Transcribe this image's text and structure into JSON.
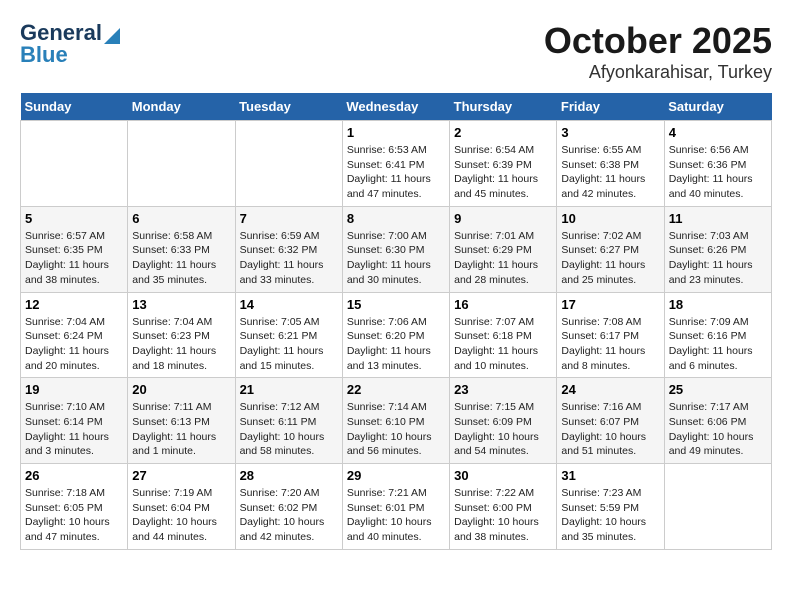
{
  "header": {
    "logo_line1": "General",
    "logo_line2": "Blue",
    "month": "October 2025",
    "location": "Afyonkarahisar, Turkey"
  },
  "days_of_week": [
    "Sunday",
    "Monday",
    "Tuesday",
    "Wednesday",
    "Thursday",
    "Friday",
    "Saturday"
  ],
  "weeks": [
    [
      {
        "day": "",
        "info": ""
      },
      {
        "day": "",
        "info": ""
      },
      {
        "day": "",
        "info": ""
      },
      {
        "day": "1",
        "info": "Sunrise: 6:53 AM\nSunset: 6:41 PM\nDaylight: 11 hours\nand 47 minutes."
      },
      {
        "day": "2",
        "info": "Sunrise: 6:54 AM\nSunset: 6:39 PM\nDaylight: 11 hours\nand 45 minutes."
      },
      {
        "day": "3",
        "info": "Sunrise: 6:55 AM\nSunset: 6:38 PM\nDaylight: 11 hours\nand 42 minutes."
      },
      {
        "day": "4",
        "info": "Sunrise: 6:56 AM\nSunset: 6:36 PM\nDaylight: 11 hours\nand 40 minutes."
      }
    ],
    [
      {
        "day": "5",
        "info": "Sunrise: 6:57 AM\nSunset: 6:35 PM\nDaylight: 11 hours\nand 38 minutes."
      },
      {
        "day": "6",
        "info": "Sunrise: 6:58 AM\nSunset: 6:33 PM\nDaylight: 11 hours\nand 35 minutes."
      },
      {
        "day": "7",
        "info": "Sunrise: 6:59 AM\nSunset: 6:32 PM\nDaylight: 11 hours\nand 33 minutes."
      },
      {
        "day": "8",
        "info": "Sunrise: 7:00 AM\nSunset: 6:30 PM\nDaylight: 11 hours\nand 30 minutes."
      },
      {
        "day": "9",
        "info": "Sunrise: 7:01 AM\nSunset: 6:29 PM\nDaylight: 11 hours\nand 28 minutes."
      },
      {
        "day": "10",
        "info": "Sunrise: 7:02 AM\nSunset: 6:27 PM\nDaylight: 11 hours\nand 25 minutes."
      },
      {
        "day": "11",
        "info": "Sunrise: 7:03 AM\nSunset: 6:26 PM\nDaylight: 11 hours\nand 23 minutes."
      }
    ],
    [
      {
        "day": "12",
        "info": "Sunrise: 7:04 AM\nSunset: 6:24 PM\nDaylight: 11 hours\nand 20 minutes."
      },
      {
        "day": "13",
        "info": "Sunrise: 7:04 AM\nSunset: 6:23 PM\nDaylight: 11 hours\nand 18 minutes."
      },
      {
        "day": "14",
        "info": "Sunrise: 7:05 AM\nSunset: 6:21 PM\nDaylight: 11 hours\nand 15 minutes."
      },
      {
        "day": "15",
        "info": "Sunrise: 7:06 AM\nSunset: 6:20 PM\nDaylight: 11 hours\nand 13 minutes."
      },
      {
        "day": "16",
        "info": "Sunrise: 7:07 AM\nSunset: 6:18 PM\nDaylight: 11 hours\nand 10 minutes."
      },
      {
        "day": "17",
        "info": "Sunrise: 7:08 AM\nSunset: 6:17 PM\nDaylight: 11 hours\nand 8 minutes."
      },
      {
        "day": "18",
        "info": "Sunrise: 7:09 AM\nSunset: 6:16 PM\nDaylight: 11 hours\nand 6 minutes."
      }
    ],
    [
      {
        "day": "19",
        "info": "Sunrise: 7:10 AM\nSunset: 6:14 PM\nDaylight: 11 hours\nand 3 minutes."
      },
      {
        "day": "20",
        "info": "Sunrise: 7:11 AM\nSunset: 6:13 PM\nDaylight: 11 hours\nand 1 minute."
      },
      {
        "day": "21",
        "info": "Sunrise: 7:12 AM\nSunset: 6:11 PM\nDaylight: 10 hours\nand 58 minutes."
      },
      {
        "day": "22",
        "info": "Sunrise: 7:14 AM\nSunset: 6:10 PM\nDaylight: 10 hours\nand 56 minutes."
      },
      {
        "day": "23",
        "info": "Sunrise: 7:15 AM\nSunset: 6:09 PM\nDaylight: 10 hours\nand 54 minutes."
      },
      {
        "day": "24",
        "info": "Sunrise: 7:16 AM\nSunset: 6:07 PM\nDaylight: 10 hours\nand 51 minutes."
      },
      {
        "day": "25",
        "info": "Sunrise: 7:17 AM\nSunset: 6:06 PM\nDaylight: 10 hours\nand 49 minutes."
      }
    ],
    [
      {
        "day": "26",
        "info": "Sunrise: 7:18 AM\nSunset: 6:05 PM\nDaylight: 10 hours\nand 47 minutes."
      },
      {
        "day": "27",
        "info": "Sunrise: 7:19 AM\nSunset: 6:04 PM\nDaylight: 10 hours\nand 44 minutes."
      },
      {
        "day": "28",
        "info": "Sunrise: 7:20 AM\nSunset: 6:02 PM\nDaylight: 10 hours\nand 42 minutes."
      },
      {
        "day": "29",
        "info": "Sunrise: 7:21 AM\nSunset: 6:01 PM\nDaylight: 10 hours\nand 40 minutes."
      },
      {
        "day": "30",
        "info": "Sunrise: 7:22 AM\nSunset: 6:00 PM\nDaylight: 10 hours\nand 38 minutes."
      },
      {
        "day": "31",
        "info": "Sunrise: 7:23 AM\nSunset: 5:59 PM\nDaylight: 10 hours\nand 35 minutes."
      },
      {
        "day": "",
        "info": ""
      }
    ]
  ]
}
